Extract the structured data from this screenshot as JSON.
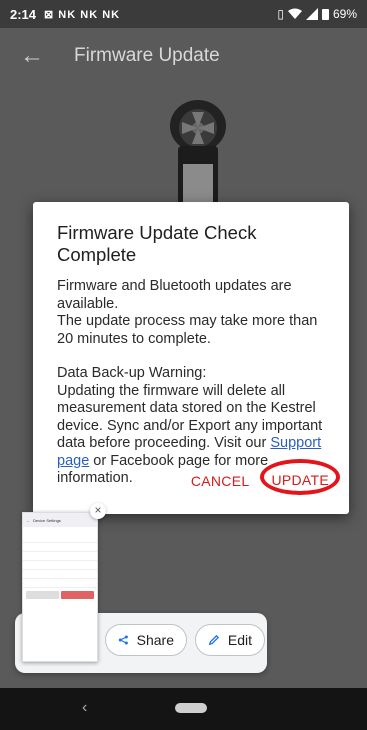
{
  "status_bar": {
    "time": "2:14",
    "notifications": "⊠ NK NK NK",
    "battery": "69%"
  },
  "app_bar": {
    "back_icon": "←",
    "title": "Firmware Update"
  },
  "dialog": {
    "title": "Firmware Update Check Complete",
    "para1": "Firmware and Bluetooth updates are available.",
    "para2": "The update process may take more than 20 minutes to complete.",
    "warning_title": "Data Back-up Warning:",
    "warning_body_1": "Updating the firmware will delete all measurement data stored on the Kestrel device. Sync and/or Export any important data before proceeding. Visit our",
    "support_link": "Support page",
    "warning_body_2": " or Facebook page for more information.",
    "cancel_label": "CANCEL",
    "update_label": "UPDATE"
  },
  "screenshot_toolbar": {
    "share_label": "Share",
    "edit_label": "Edit",
    "close_icon": "×"
  },
  "thumbnail": {
    "title": "Device Settings",
    "buttons": [
      "Forget Device",
      "Disconnect"
    ]
  },
  "colors": {
    "accent": "#d81b1b",
    "highlight_ring": "#e3151a",
    "link": "#2b5fbf"
  }
}
